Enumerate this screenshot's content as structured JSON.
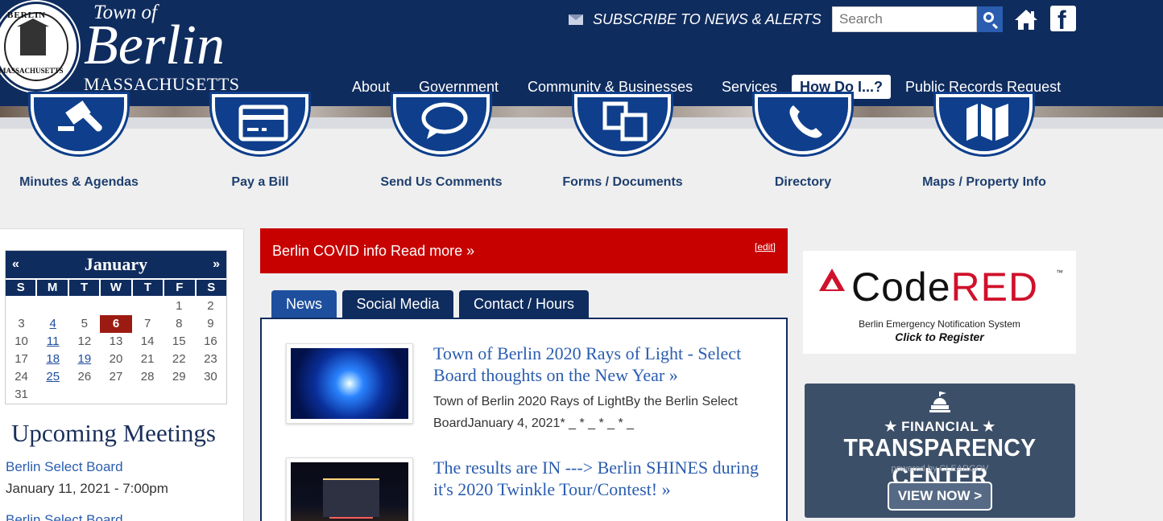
{
  "header": {
    "seal_top": "BERLIN",
    "seal_bottom": "MASSACHUSETTS",
    "town_of": "Town of",
    "town_name": "Berlin",
    "state": "MASSACHUSETTS",
    "subscribe": "SUBSCRIBE TO NEWS & ALERTS",
    "search_placeholder": "Search",
    "facebook_glyph": "f"
  },
  "nav": [
    {
      "label": "About"
    },
    {
      "label": "Government"
    },
    {
      "label": "Community & Businesses"
    },
    {
      "label": "Services"
    },
    {
      "label": "How Do I...?"
    },
    {
      "label": "Public Records Request"
    }
  ],
  "quick_links": [
    {
      "label": "Minutes & Agendas",
      "icon": "gavel-icon"
    },
    {
      "label": "Pay a Bill",
      "icon": "credit-card-icon"
    },
    {
      "label": "Send Us Comments",
      "icon": "speech-bubble-icon"
    },
    {
      "label": "Forms / Documents",
      "icon": "documents-icon"
    },
    {
      "label": "Directory",
      "icon": "phone-icon"
    },
    {
      "label": "Maps / Property Info",
      "icon": "map-icon"
    }
  ],
  "calendar": {
    "month": "January",
    "prev": "«",
    "next": "»",
    "weekdays": [
      "S",
      "M",
      "T",
      "W",
      "T",
      "F",
      "S"
    ],
    "rows": [
      [
        "",
        "",
        "",
        "",
        "",
        "1",
        "2"
      ],
      [
        "3",
        "4",
        "5",
        "6",
        "7",
        "8",
        "9"
      ],
      [
        "10",
        "11",
        "12",
        "13",
        "14",
        "15",
        "16"
      ],
      [
        "17",
        "18",
        "19",
        "20",
        "21",
        "22",
        "23"
      ],
      [
        "24",
        "25",
        "26",
        "27",
        "28",
        "29",
        "30"
      ],
      [
        "31",
        "",
        "",
        "",
        "",
        "",
        ""
      ]
    ],
    "linked_days": [
      "4",
      "11",
      "18",
      "19",
      "25"
    ],
    "today": "6"
  },
  "upcoming": {
    "title": "Upcoming Meetings",
    "meetings": [
      {
        "name": "Berlin Select Board",
        "time": "January 11, 2021 - 7:00pm"
      },
      {
        "name": "Berlin Select Board"
      }
    ]
  },
  "alert": {
    "text": "Berlin COVID info Read more »",
    "edit": "[edit]",
    "color": "#c70000"
  },
  "tabs": [
    {
      "label": "News"
    },
    {
      "label": "Social Media"
    },
    {
      "label": "Contact / Hours"
    }
  ],
  "news": [
    {
      "title": "Town of Berlin 2020 Rays of Light - Select Board thoughts on the New Year »",
      "body": "Town of Berlin 2020 Rays of LightBy the Berlin Select BoardJanuary 4, 2021* _ * _ * _ * _"
    },
    {
      "title": "The results are IN ---> Berlin SHINES during it's 2020 Twinkle Tour/Contest! »"
    }
  ],
  "codered": {
    "name_black": "Code",
    "name_red": "RED",
    "tm": "™",
    "subtitle": "Berlin Emergency Notification System",
    "cta": "Click to Register"
  },
  "transparency": {
    "financial": "★ FINANCIAL ★",
    "center": "TRANSPARENCY CENTER",
    "powered": "powered by CLEARGOV",
    "button": "VIEW NOW >"
  },
  "colors": {
    "header_bg": "#0f2c5e",
    "link": "#2a5db0",
    "today": "#9b1b12"
  }
}
